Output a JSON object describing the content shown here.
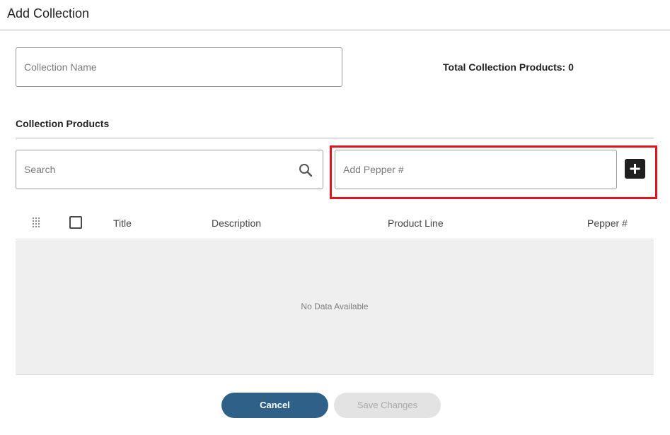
{
  "dialog": {
    "title": "Add Collection"
  },
  "collection_name": {
    "placeholder": "Collection Name",
    "value": ""
  },
  "total_products": {
    "label": "Total Collection Products: 0"
  },
  "products_section": {
    "title": "Collection Products"
  },
  "search": {
    "placeholder": "Search",
    "value": "",
    "icon": "search-icon"
  },
  "add_pepper": {
    "placeholder": "Add Pepper #",
    "value": "",
    "add_icon": "plus-icon",
    "highlight_color": "#e0141e"
  },
  "table": {
    "drag_icon": "drag-handle-icon",
    "columns": [
      "Title",
      "Description",
      "Product Line",
      "Pepper #"
    ],
    "rows": [],
    "empty_message": "No Data Available"
  },
  "actions": {
    "cancel_label": "Cancel",
    "save_label": "Save Changes",
    "save_disabled": true
  },
  "colors": {
    "primary_button": "#2e6088",
    "disabled_button": "#e3e3e3",
    "table_body_bg": "#efefef"
  }
}
